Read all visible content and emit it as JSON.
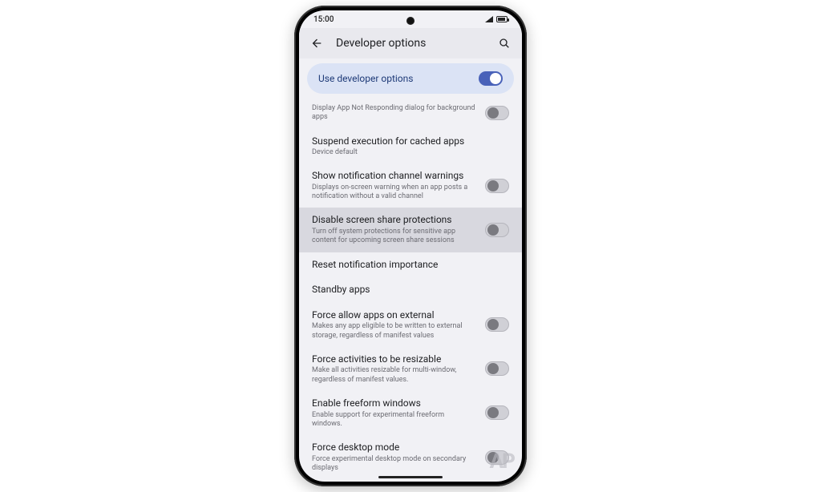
{
  "statusbar": {
    "time": "15:00"
  },
  "appbar": {
    "title": "Developer options"
  },
  "pinned": {
    "label": "Use developer options",
    "state": "on"
  },
  "settings": [
    {
      "id": "anr",
      "title": "",
      "sub": "Display App Not Responding dialog for background apps",
      "toggle": "off",
      "partial": true
    },
    {
      "id": "suspend",
      "title": "Suspend execution for cached apps",
      "sub": "Device default",
      "toggle": null
    },
    {
      "id": "channel-warn",
      "title": "Show notification channel warnings",
      "sub": "Displays on-screen warning when an app posts a notification without a valid channel",
      "toggle": "off"
    },
    {
      "id": "screenshare",
      "title": "Disable screen share protections",
      "sub": "Turn off system protections for sensitive app content for upcoming screen share sessions",
      "toggle": "off",
      "highlight": true
    },
    {
      "id": "reset-notif",
      "title": "Reset notification importance",
      "sub": "",
      "toggle": null
    },
    {
      "id": "standby",
      "title": "Standby apps",
      "sub": "",
      "toggle": null
    },
    {
      "id": "force-ext",
      "title": "Force allow apps on external",
      "sub": "Makes any app eligible to be written to external storage, regardless of manifest values",
      "toggle": "off"
    },
    {
      "id": "force-resize",
      "title": "Force activities to be resizable",
      "sub": "Make all activities resizable for multi-window, regardless of manifest values.",
      "toggle": "off"
    },
    {
      "id": "freeform",
      "title": "Enable freeform windows",
      "sub": "Enable support for experimental freeform windows.",
      "toggle": "off"
    },
    {
      "id": "desktop",
      "title": "Force desktop mode",
      "sub": "Force experimental desktop mode on secondary displays",
      "toggle": "off"
    }
  ],
  "watermark": "AP"
}
